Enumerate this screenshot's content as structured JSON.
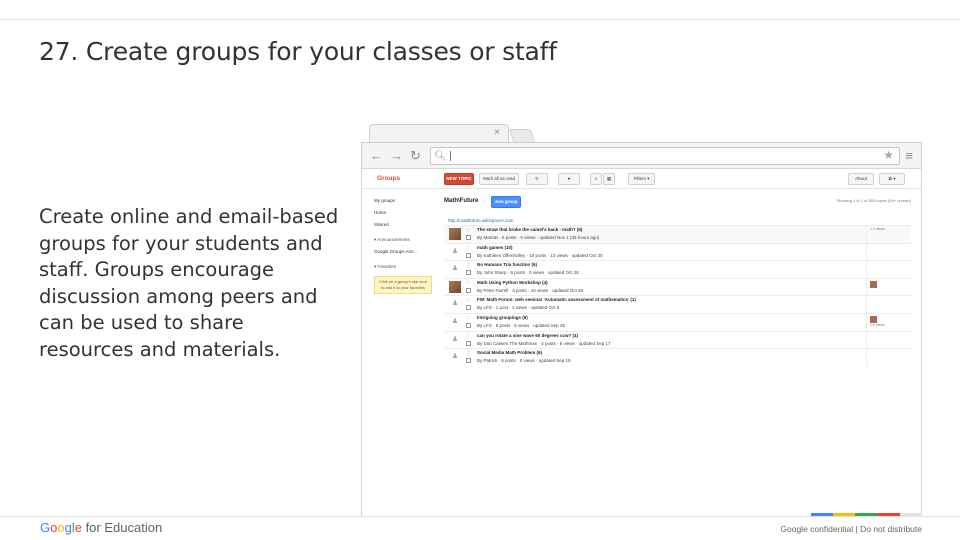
{
  "slide": {
    "title": "27. Create groups for your classes or staff",
    "body": "Create online and email-based groups for your students and staff. Groups encourage discussion among peers and can be used to share resources and materials."
  },
  "browser": {
    "tab_close": "×",
    "back_icon": "arrow-left-icon",
    "forward_icon": "arrow-right-icon",
    "reload_icon": "reload-icon",
    "star_icon": "star-icon",
    "menu_icon": "menu-icon"
  },
  "groups_app": {
    "logo": "Groups",
    "toolbar": {
      "new_topic": "NEW TOPIC",
      "mark_all_read": "Mark all as read",
      "filters": "Filters ▾",
      "about": "About",
      "settings": "✿ ▾"
    },
    "sidebar": {
      "items": [
        "My groups",
        "Home",
        "Starred"
      ],
      "announcements_head": "▾ Announcements",
      "announcements_item": "Google Groups Ann...",
      "favorites_head": "▾ Favorites",
      "favorites_note": "Click on a group's star icon to add it to your favorites"
    },
    "group_name": "Math\\Future",
    "join_button": "Join group",
    "showing": "Showing 1 to 1 of 500 topics (99+ unread)",
    "group_url": "http://mathfuture.wikispaces.com",
    "topics": [
      {
        "title": "The straw that broke the camel's back - math? (6)",
        "meta": "By MariaD · 6 posts · 0 views · updated Nov 1 (39 hours ago)",
        "avatar": "photo",
        "right": "1.2 views",
        "shade": true
      },
      {
        "title": "math games (10)",
        "meta": "By Kathleen Offenholley · 10 posts · 13 views · updated Oct 30",
        "avatar": "generic",
        "right": "",
        "shade": false
      },
      {
        "title": "No Humans Tria function (6)",
        "meta": "By John Sharp · 6 posts · 0 views · updated Oct 28",
        "avatar": "generic",
        "right": "",
        "shade": false
      },
      {
        "title": "Math Using Python Workshop (4)",
        "meta": "By Peter Farrell · 4 posts · 10 views · updated Oct 26",
        "avatar": "photo",
        "right": "thumb",
        "shade": false
      },
      {
        "title": "FW: Math Forum: web seminar 'Automatic assessment of mathematics' (1)",
        "meta": "By LFS · 1 post · 2 views · updated Oct 5",
        "avatar": "generic",
        "right": "",
        "shade": false
      },
      {
        "title": "Intriguing groupings (8)",
        "meta": "By LFS · 8 posts · 5 views · updated Sep 25",
        "avatar": "generic",
        "right": "thumb-views",
        "shade": false
      },
      {
        "title": "can you rotate a sine wave 60 degrees ccw? (4)",
        "meta": "By Dan Catwen The Mathman · 4 posts · 8 views · updated Sep 17",
        "avatar": "generic",
        "right": "",
        "shade": false
      },
      {
        "title": "Social Media Math Problem (6)",
        "meta": "By Patrick · 6 posts · 0 views · updated Sep 15",
        "avatar": "generic",
        "right": "",
        "shade": false
      }
    ],
    "right_small_views": "1.6 views"
  },
  "footer": {
    "logo_google": "Google",
    "logo_suffix": " for Education",
    "confidential": "Google confidential | Do not distribute",
    "colors": [
      "#4285f4",
      "#fbbc05",
      "#34a853",
      "#ea4335",
      "#e3e3e3"
    ]
  }
}
